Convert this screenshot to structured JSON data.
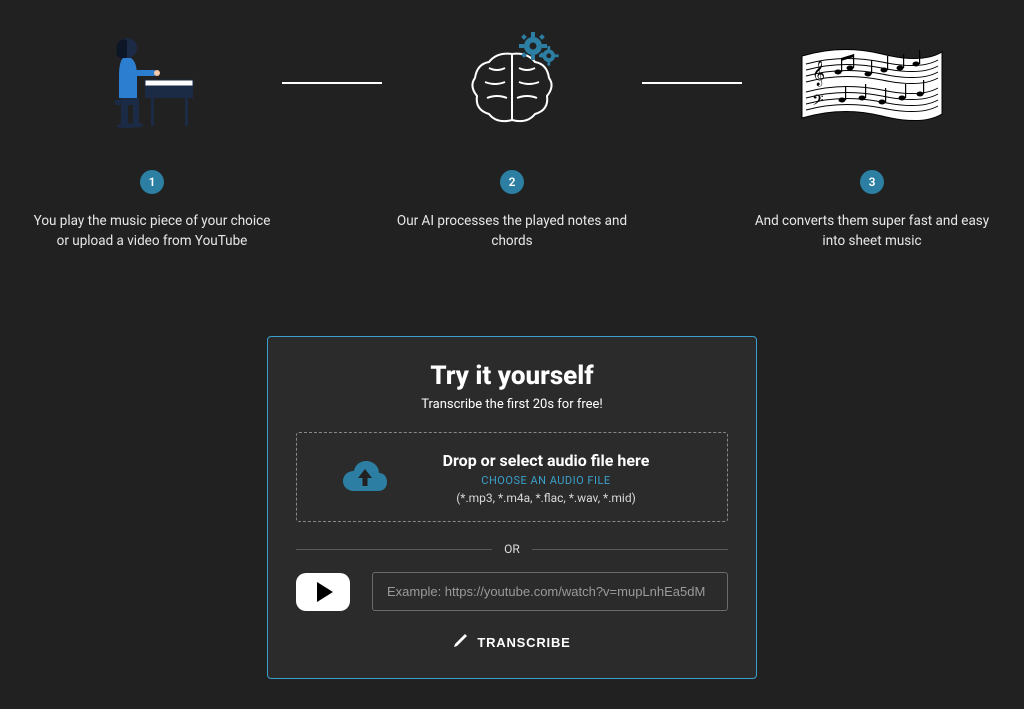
{
  "steps": [
    {
      "num": "1",
      "text": "You play the music piece of your choice or upload a video from YouTube"
    },
    {
      "num": "2",
      "text": "Our AI processes the played notes and chords"
    },
    {
      "num": "3",
      "text": "And converts them super fast and easy into sheet music"
    }
  ],
  "tryCard": {
    "title": "Try it yourself",
    "subtitle": "Transcribe the first 20s for free!",
    "dropHeadline": "Drop or select audio file here",
    "chooseLink": "CHOOSE AN AUDIO FILE",
    "fileTypes": "(*.mp3, *.m4a, *.flac, *.wav, *.mid)",
    "orLabel": "OR",
    "ytPlaceholder": "Example: https://youtube.com/watch?v=mupLnhEa5dM",
    "transcribe": "TRANSCRIBE"
  },
  "colors": {
    "accent": "#3aa0c9",
    "badge": "#2c7fa3"
  }
}
